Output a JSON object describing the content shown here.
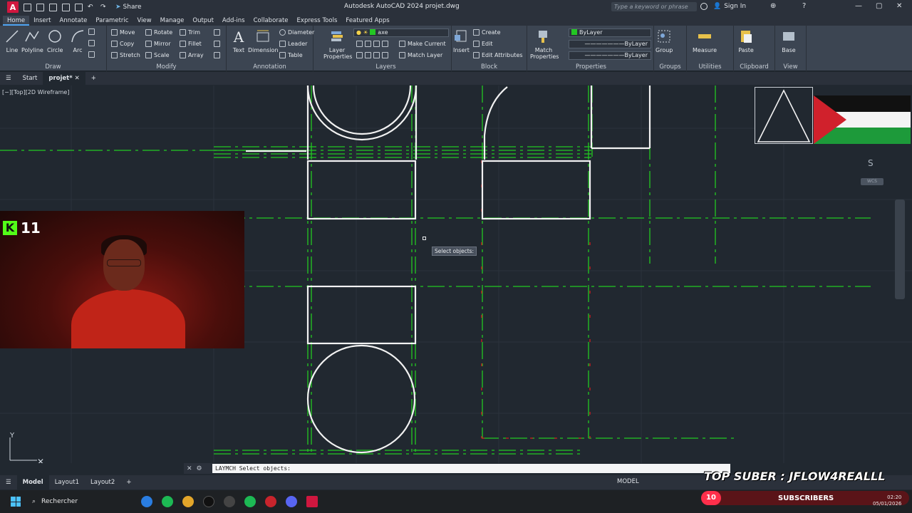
{
  "titlebar": {
    "app_initial": "A",
    "share_label": "Share",
    "window_title": "Autodesk AutoCAD 2024   projet.dwg",
    "search_placeholder": "Type a keyword or phrase",
    "sign_in": "Sign In"
  },
  "ribbon_tabs": [
    "Home",
    "Insert",
    "Annotate",
    "Parametric",
    "View",
    "Manage",
    "Output",
    "Add-ins",
    "Collaborate",
    "Express Tools",
    "Featured Apps"
  ],
  "ribbon": {
    "draw": {
      "title": "Draw",
      "line": "Line",
      "polyline": "Polyline",
      "circle": "Circle",
      "arc": "Arc"
    },
    "modify": {
      "title": "Modify",
      "move": "Move",
      "rotate": "Rotate",
      "trim": "Trim",
      "copy": "Copy",
      "mirror": "Mirror",
      "fillet": "Fillet",
      "stretch": "Stretch",
      "scale": "Scale",
      "array": "Array"
    },
    "annotation": {
      "title": "Annotation",
      "text": "Text",
      "dimension": "Dimension",
      "diameter": "Diameter",
      "leader": "Leader",
      "table": "Table"
    },
    "layers": {
      "title": "Layers",
      "layer_properties": "Layer Properties",
      "current_layer": "axe",
      "make_current": "Make Current",
      "match_layer": "Match Layer"
    },
    "block": {
      "title": "Block",
      "insert": "Insert",
      "create": "Create",
      "edit": "Edit",
      "edit_attributes": "Edit Attributes"
    },
    "properties": {
      "title": "Properties",
      "match_properties": "Match Properties",
      "color": "ByLayer",
      "linetype": "ByLayer",
      "lineweight": "ByLayer"
    },
    "groups": {
      "title": "Groups",
      "group": "Group"
    },
    "utilities": {
      "title": "Utilities",
      "measure": "Measure"
    },
    "clipboard": {
      "title": "Clipboard",
      "paste": "Paste"
    },
    "view": {
      "title": "View",
      "base": "Base"
    }
  },
  "file_tabs": [
    "Start",
    "projet*"
  ],
  "canvas": {
    "viewport_label": "[−][Top][2D Wireframe]",
    "tooltip": "Select objects:",
    "viewcube_letter": "S",
    "wcs": "WCS",
    "ucs_y": "Y"
  },
  "webcam": {
    "kick_logo": "K",
    "viewer_count": "11"
  },
  "command": {
    "text": "LAYMCH Select objects:"
  },
  "layout_tabs": [
    "Model",
    "Layout1",
    "Layout2"
  ],
  "status": {
    "model": "MODEL"
  },
  "overlay": {
    "top_suber": "TOP SUBER : JFLOW4REALLL",
    "sub_count": "10",
    "sub_label": "SUBSCRIBERS"
  },
  "taskbar": {
    "search": "Rechercher",
    "time": "02:20",
    "date": "05/01/2026"
  },
  "colors": {
    "accent": "#4ea3f1",
    "axis_green": "#22c922",
    "red_dashes": "#d01e1e",
    "canvas": "#212830"
  }
}
